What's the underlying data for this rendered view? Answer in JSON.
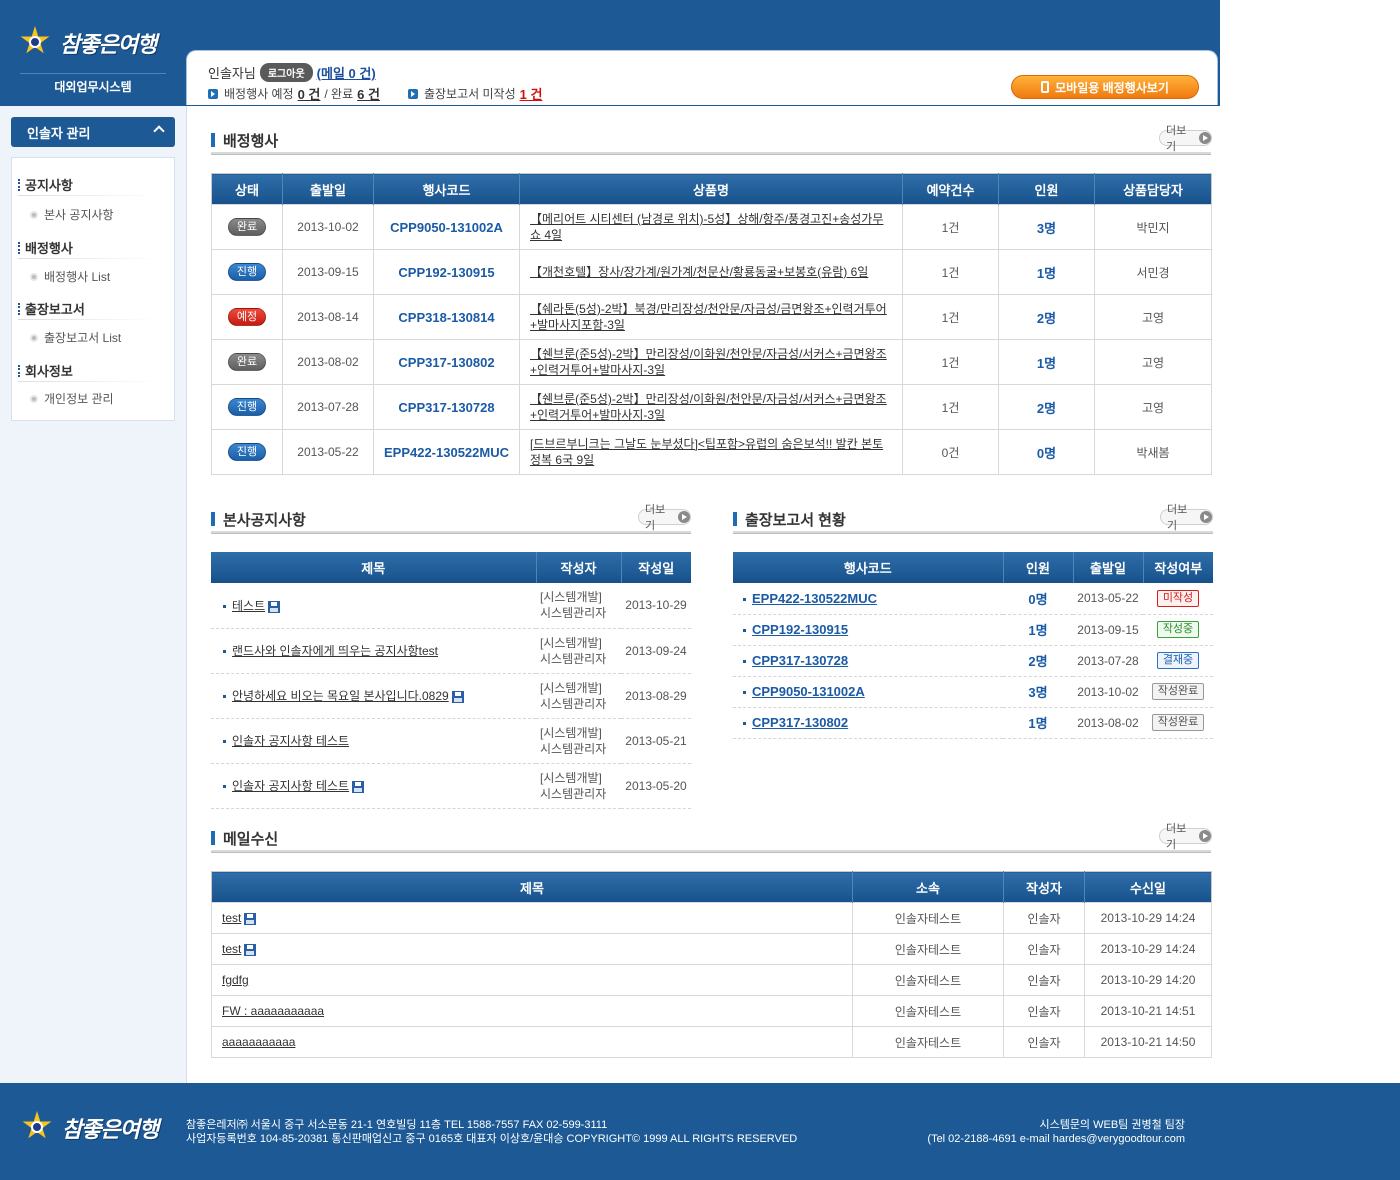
{
  "brand": {
    "logo_text": "참좋은여행",
    "system_name": "대외업무시스템"
  },
  "user": {
    "name_suffix": "인솔자님",
    "logout_label": "로그아웃",
    "mail_label": "(메일 0 건)",
    "assigned_label": "배정행사 예정",
    "assigned_planned": "0 건",
    "assigned_sep": "/ 완료",
    "assigned_done": "6 건",
    "report_label": "출장보고서 미작성",
    "report_count": "1 건",
    "mobile_button": "모바일용 배정행사보기"
  },
  "sidebar": {
    "header": "인솔자 관리",
    "groups": [
      {
        "label": "공지사항",
        "item": "본사 공지사항"
      },
      {
        "label": "배정행사",
        "item": "배정행사 List"
      },
      {
        "label": "출장보고서",
        "item": "출장보고서 List"
      },
      {
        "label": "회사정보",
        "item": "개인정보 관리"
      }
    ]
  },
  "more_label": "더보기",
  "events": {
    "title": "배정행사",
    "columns": [
      "상태",
      "출발일",
      "행사코드",
      "상품명",
      "예약건수",
      "인원",
      "상품담당자"
    ],
    "rows": [
      {
        "status": "완료",
        "date": "2013-10-02",
        "code": "CPP9050-131002A",
        "product": "【메리어트 시티센터 (남경로 위치)-5성】상해/항주/풍경고진+송성가무쇼 4일",
        "bookings": "1건",
        "people": "3명",
        "manager": "박민지"
      },
      {
        "status": "진행",
        "date": "2013-09-15",
        "code": "CPP192-130915",
        "product": "【개천호텔】장사/장가계/원가계/천문산/황룡동굴+보봉호(유람) 6일",
        "bookings": "1건",
        "people": "1명",
        "manager": "서민경"
      },
      {
        "status": "예정",
        "date": "2013-08-14",
        "code": "CPP318-130814",
        "product": "【쉐라톤(5성)-2박】북경/만리장성/천안문/자금성/금면왕조+인력거투어+발마사지포함-3일",
        "bookings": "1건",
        "people": "2명",
        "manager": "고영"
      },
      {
        "status": "완료",
        "date": "2013-08-02",
        "code": "CPP317-130802",
        "product": "【쉔브룬(준5성)-2박】만리장성/이화원/천안문/자금성/서커스+금면왕조+인력거투어+발마사지-3일",
        "bookings": "1건",
        "people": "1명",
        "manager": "고영"
      },
      {
        "status": "진행",
        "date": "2013-07-28",
        "code": "CPP317-130728",
        "product": "【쉔브룬(준5성)-2박】만리장성/이화원/천안문/자금성/서커스+금면왕조+인력거투어+발마사지-3일",
        "bookings": "1건",
        "people": "2명",
        "manager": "고영"
      },
      {
        "status": "진행",
        "date": "2013-05-22",
        "code": "EPP422-130522MUC",
        "product": "[드브르부니크는 그날도 눈부셨다]<팁포함>유럽의 숨은보석!! 발칸 본토 정복 6국 9일",
        "bookings": "0건",
        "people": "0명",
        "manager": "박새봄"
      }
    ]
  },
  "notices": {
    "title": "본사공지사항",
    "columns": [
      "제목",
      "작성자",
      "작성일"
    ],
    "rows": [
      {
        "title": "테스트",
        "attach": true,
        "author1": "[시스템개발]",
        "author2": "시스템관리자",
        "date": "2013-10-29"
      },
      {
        "title": "랜드사와 인솔자에게 띄우는 공지사항test",
        "attach": false,
        "author1": "[시스템개발]",
        "author2": "시스템관리자",
        "date": "2013-09-24"
      },
      {
        "title": "안녕하세요 비오는 목요일 본사입니다.0829",
        "attach": true,
        "author1": "[시스템개발]",
        "author2": "시스템관리자",
        "date": "2013-08-29"
      },
      {
        "title": "인솔자 공지사항 테스트",
        "attach": false,
        "author1": "[시스템개발]",
        "author2": "시스템관리자",
        "date": "2013-05-21"
      },
      {
        "title": "인솔자 공지사항 테스트",
        "attach": true,
        "author1": "[시스템개발]",
        "author2": "시스템관리자",
        "date": "2013-05-20"
      }
    ]
  },
  "reports": {
    "title": "출장보고서 현황",
    "columns": [
      "행사코드",
      "인원",
      "출발일",
      "작성여부"
    ],
    "rows": [
      {
        "code": "EPP422-130522MUC",
        "people": "0명",
        "date": "2013-05-22",
        "status": "미작성",
        "color": "#d02020"
      },
      {
        "code": "CPP192-130915",
        "people": "1명",
        "date": "2013-09-15",
        "status": "작성중",
        "color": "#2d8a2d"
      },
      {
        "code": "CPP317-130728",
        "people": "2명",
        "date": "2013-07-28",
        "status": "결재중",
        "color": "#1f5fb0"
      },
      {
        "code": "CPP9050-131002A",
        "people": "3명",
        "date": "2013-10-02",
        "status": "작성완료",
        "color": "#555555"
      },
      {
        "code": "CPP317-130802",
        "people": "1명",
        "date": "2013-08-02",
        "status": "작성완료",
        "color": "#555555"
      }
    ]
  },
  "mail": {
    "title": "메일수신",
    "columns": [
      "제목",
      "소속",
      "작성자",
      "수신일"
    ],
    "rows": [
      {
        "title": "test",
        "attach": true,
        "org": "인솔자테스트",
        "writer": "인솔자",
        "date": "2013-10-29 14:24"
      },
      {
        "title": "test",
        "attach": true,
        "org": "인솔자테스트",
        "writer": "인솔자",
        "date": "2013-10-29 14:24"
      },
      {
        "title": "fgdfg",
        "attach": false,
        "org": "인솔자테스트",
        "writer": "인솔자",
        "date": "2013-10-29 14:20"
      },
      {
        "title": "FW : aaaaaaaaaaa",
        "attach": false,
        "org": "인솔자테스트",
        "writer": "인솔자",
        "date": "2013-10-21 14:51"
      },
      {
        "title": "aaaaaaaaaaa",
        "attach": false,
        "org": "인솔자테스트",
        "writer": "인솔자",
        "date": "2013-10-21 14:50"
      }
    ]
  },
  "footer": {
    "line1": "참좋은레저㈜ 서울시 중구 서소문동 21-1 연호빌딩 11층 TEL 1588-7557  FAX 02-599-3111",
    "line2": "사업자등록번호 104-85-20381  통신판매업신고 중구 0165호 대표자 이상호/윤대승  COPYRIGHT© 1999 ALL RIGHTS RESERVED",
    "right1": "시스템문의 WEB팀 권병철 팀장",
    "right2": "(Tel 02-2188-4691 e-mail hardes@verygoodtour.com"
  }
}
